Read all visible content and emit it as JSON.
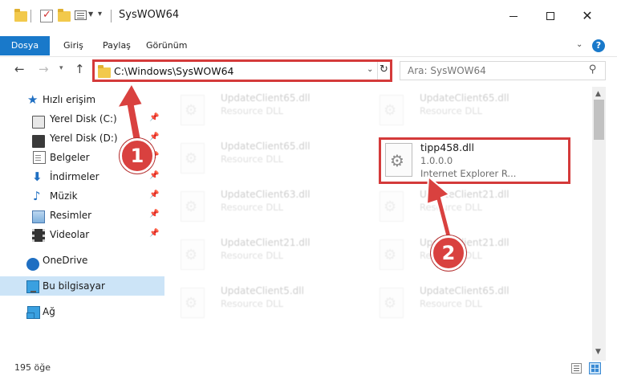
{
  "window": {
    "title": "SysWOW64"
  },
  "ribbon": {
    "tabs": [
      {
        "label": "Dosya"
      },
      {
        "label": "Giriş"
      },
      {
        "label": "Paylaş"
      },
      {
        "label": "Görünüm"
      }
    ],
    "help": "?"
  },
  "navigation": {
    "address": "C:\\Windows\\SysWOW64",
    "search_placeholder": "Ara: SysWOW64"
  },
  "sidebar": {
    "items": [
      {
        "label": "Hızlı erişim",
        "icon": "star-icon"
      },
      {
        "label": "Yerel Disk (C:)",
        "icon": "drive-icon"
      },
      {
        "label": "Yerel Disk (D:)",
        "icon": "drive-icon"
      },
      {
        "label": "Belgeler",
        "icon": "documents-icon"
      },
      {
        "label": "İndirmeler",
        "icon": "downloads-icon"
      },
      {
        "label": "Müzik",
        "icon": "music-icon"
      },
      {
        "label": "Resimler",
        "icon": "pictures-icon"
      },
      {
        "label": "Videolar",
        "icon": "videos-icon"
      },
      {
        "label": "OneDrive",
        "icon": "onedrive-icon"
      },
      {
        "label": "Bu bilgisayar",
        "icon": "computer-icon"
      },
      {
        "label": "Ağ",
        "icon": "network-icon"
      }
    ]
  },
  "files": [
    {
      "name": "UpdateClient65.dll",
      "desc": "Resource DLL"
    },
    {
      "name": "UpdateClient65.dll",
      "desc": "Resource DLL"
    },
    {
      "name": "UpdateClient65.dll",
      "desc": "Resource DLL"
    },
    {
      "name": "UpdateClient63.dll",
      "desc": "Resource DLL"
    },
    {
      "name": "UpdateClient21.dll",
      "desc": "Resource DLL"
    },
    {
      "name": "UpdateClient21.dll",
      "desc": "Resource DLL"
    },
    {
      "name": "UpdateClient21.dll",
      "desc": "Resource DLL"
    },
    {
      "name": "UpdateClient5.dll",
      "desc": "Resource DLL"
    },
    {
      "name": "UpdateClient65.dll",
      "desc": "Resource DLL"
    }
  ],
  "highlighted_file": {
    "name": "tipp458.dll",
    "version": "1.0.0.0",
    "company": "Internet Explorer R..."
  },
  "status": {
    "item_count": "195 öğe"
  },
  "annotations": {
    "step1": "1",
    "step2": "2",
    "color": "#d9413f"
  },
  "colors": {
    "accent": "#1979ca",
    "highlight_border": "#d43a3a",
    "selected_bg": "#cce4f7"
  }
}
